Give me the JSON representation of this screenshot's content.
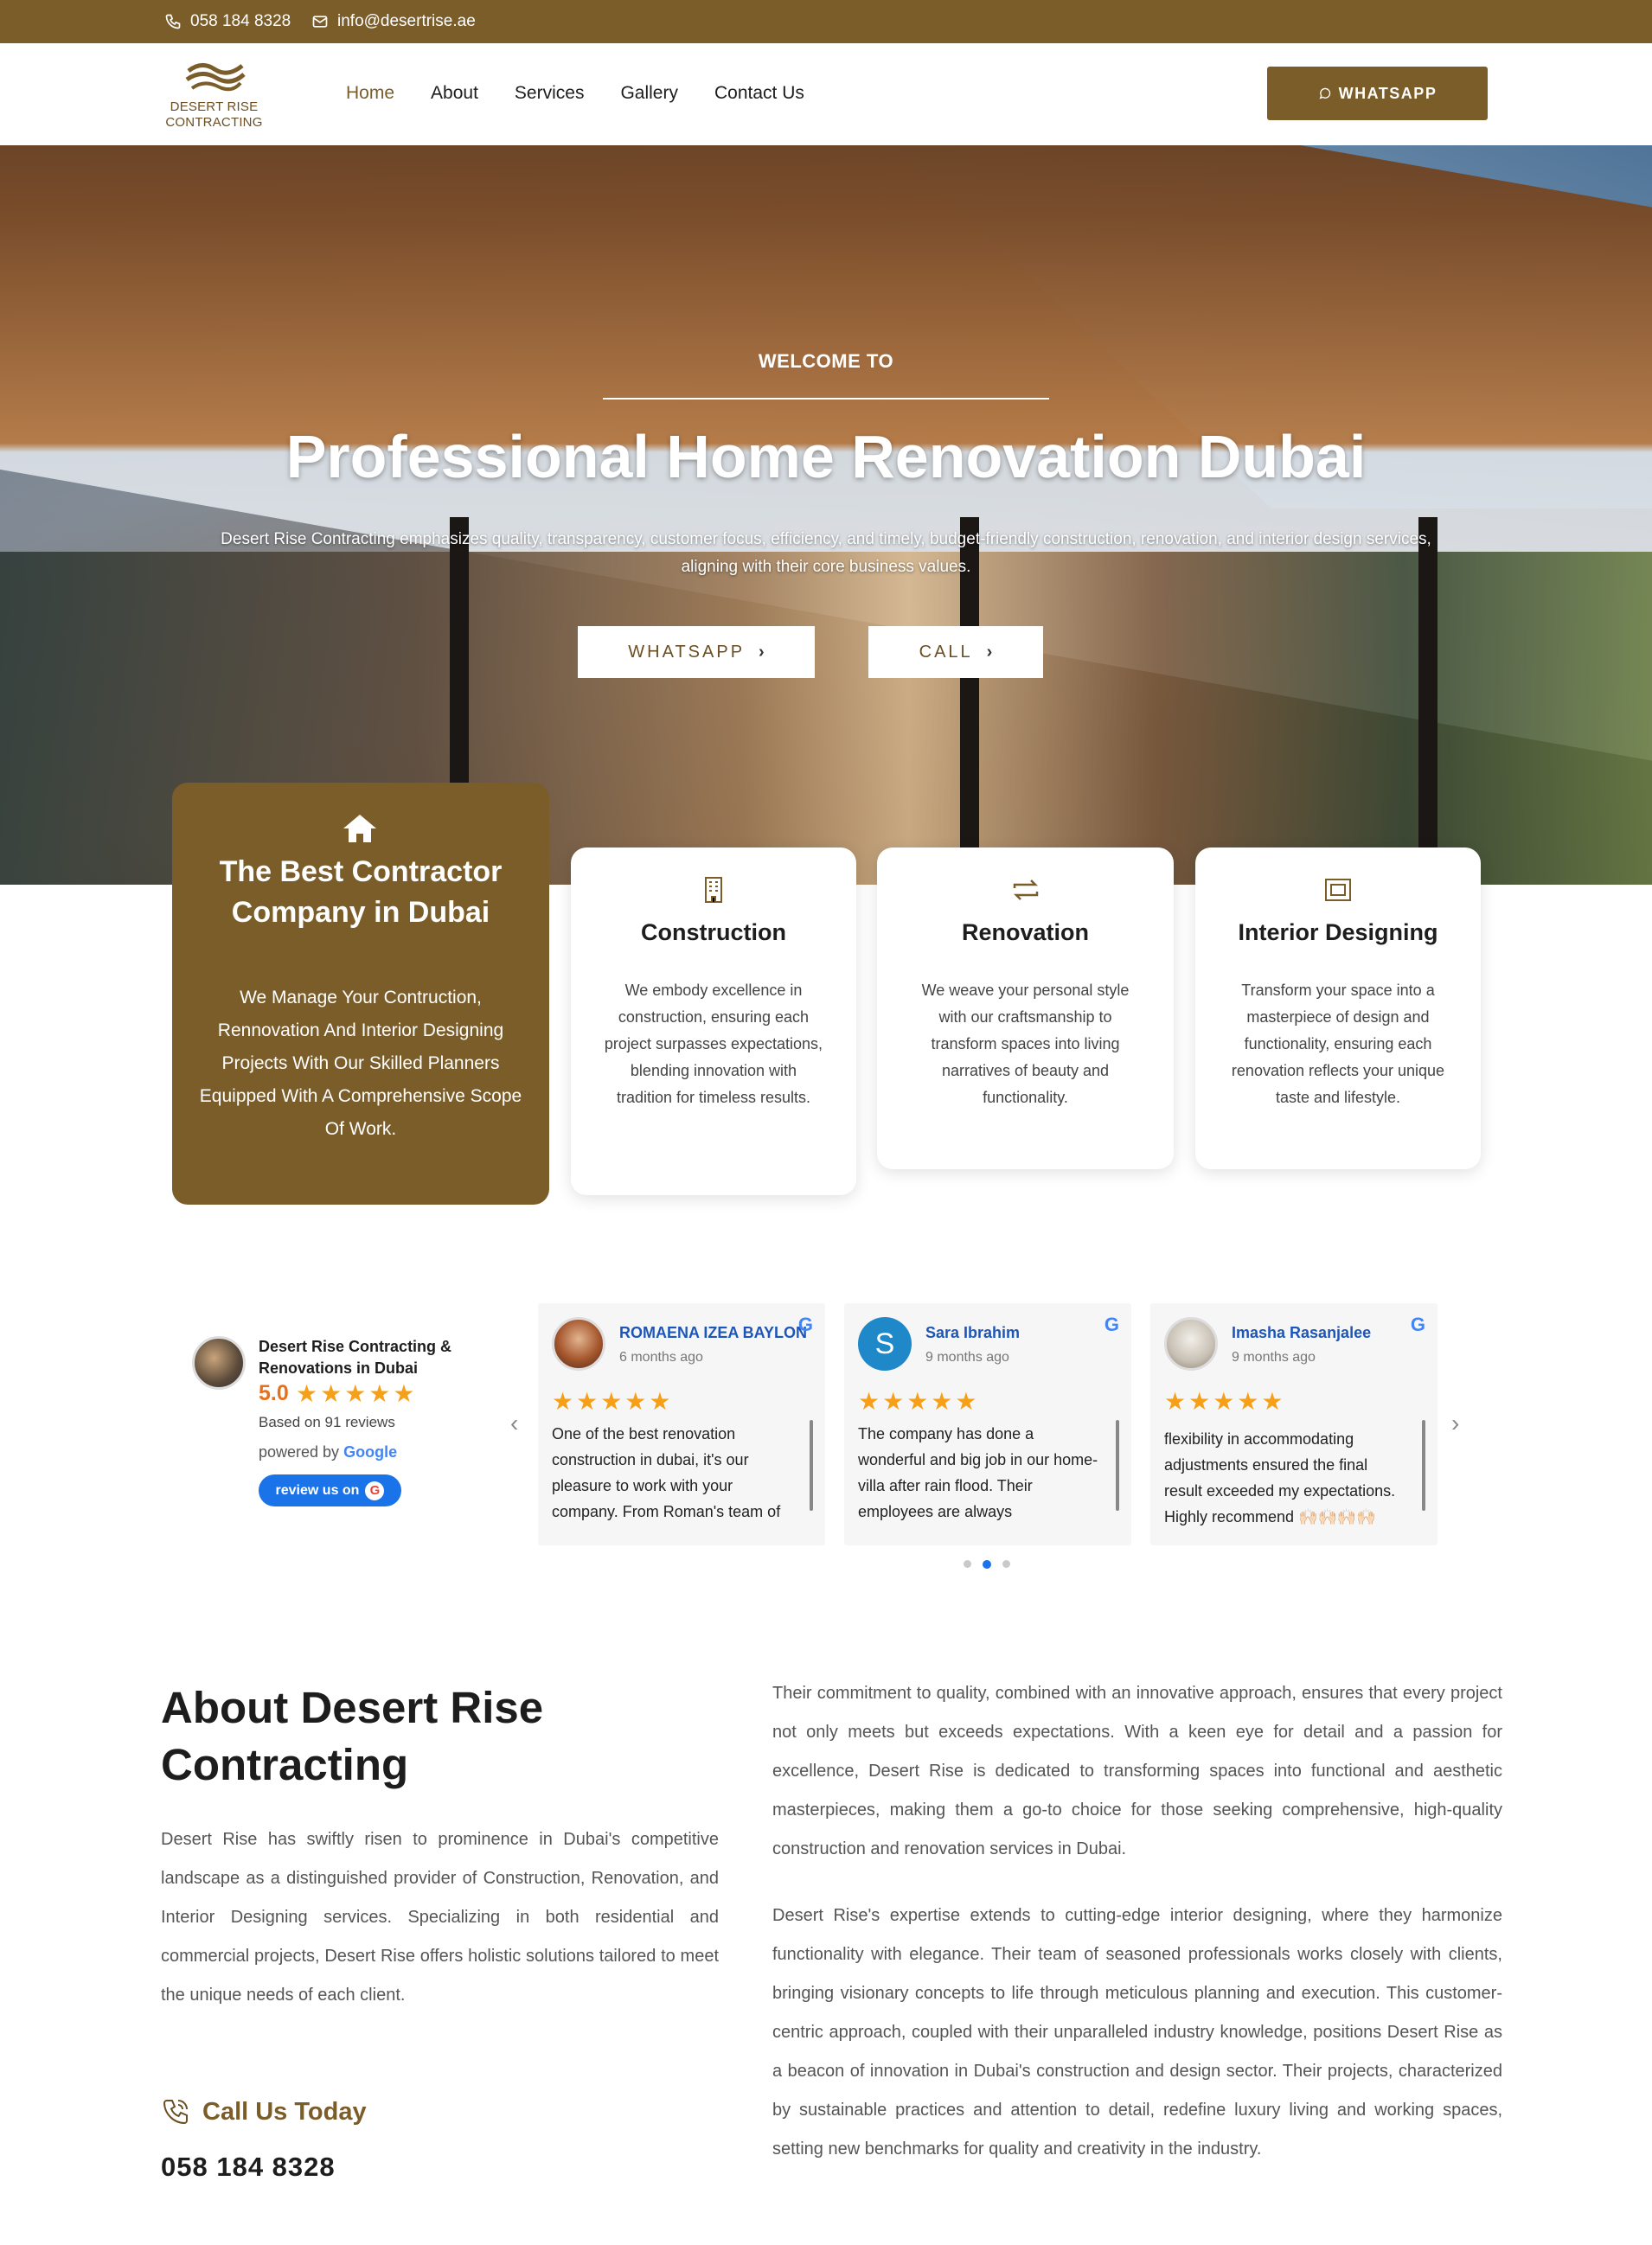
{
  "topbar": {
    "phone": "058 184 8328",
    "email": "info@desertrise.ae",
    "phone_icon": "phone-icon",
    "email_icon": "mail-icon"
  },
  "logo": {
    "line1": "DESERT RISE",
    "line2": "CONTRACTING"
  },
  "nav": {
    "items": [
      {
        "label": "Home",
        "active": true
      },
      {
        "label": "About",
        "active": false
      },
      {
        "label": "Services",
        "active": false
      },
      {
        "label": "Gallery",
        "active": false
      },
      {
        "label": "Contact Us",
        "active": false
      }
    ],
    "whatsapp_label": "WHATSAPP"
  },
  "hero": {
    "welcome": "WELCOME TO",
    "title": "Professional Home Renovation Dubai",
    "subtitle": "Desert Rise Contracting emphasizes quality, transparency, customer focus, efficiency, and timely, budget-friendly construction, renovation, and interior design services, aligning with their core business values.",
    "buttons": {
      "whatsapp": "WHATSAPP",
      "call": "CALL"
    }
  },
  "features": {
    "best": {
      "title": "The Best Contractor Company in Dubai",
      "description": "We Manage Your Contruction, Rennovation And Interior Designing Projects With Our Skilled Planners Equipped With A Comprehensive Scope Of Work."
    },
    "cards": [
      {
        "icon": "building-icon",
        "title": "Construction",
        "description": "We embody excellence in construction, ensuring each project surpasses expectations, blending innovation with tradition for timeless results."
      },
      {
        "icon": "repeat-icon",
        "title": "Renovation",
        "description": "We weave your personal style with our craftsmanship to transform spaces into living narratives of beauty and functionality."
      },
      {
        "icon": "frame-icon",
        "title": "Interior Designing",
        "description": "Transform your space into a masterpiece of design and functionality, ensuring each renovation reflects your unique taste and lifestyle."
      }
    ]
  },
  "reviews": {
    "business_name": "Desert Rise Contracting & Renovations in Dubai",
    "score": "5.0",
    "stars": "★★★★★",
    "based_on": "Based on 91 reviews",
    "powered_by": "powered by",
    "google": "Google",
    "review_button": "review us on",
    "items": [
      {
        "name": "ROMAENA IZEA BAYLON",
        "date": "6 months ago",
        "stars": "★★★★★",
        "text": "One of the best renovation construction in dubai, it's our pleasure to work with your company. From Roman's team of"
      },
      {
        "name": "Sara Ibrahim",
        "date": "9 months ago",
        "stars": "★★★★★",
        "initial": "S",
        "text": "The company has done a wonderful and big job in our home-villa after rain flood. Their employees are always"
      },
      {
        "name": "Imasha Rasanjalee",
        "date": "9 months ago",
        "stars": "★★★★★",
        "text": "flexibility in accommodating adjustments ensured the final result exceeded my expectations. Highly recommend 🙌🏻🙌🏻🙌🏻🙌🏻"
      }
    ],
    "active_dot": 1
  },
  "about": {
    "title": "About Desert Rise Contracting",
    "paragraph": "Desert Rise has swiftly risen to prominence in Dubai's competitive landscape as a distinguished provider of Construction, Renovation, and Interior Designing services. Specializing in both residential and commercial projects, Desert Rise offers holistic solutions tailored to meet the unique needs of each client.",
    "call_label": "Call Us Today",
    "call_number": "058 184 8328",
    "right_p1": "Their commitment to quality, combined with an innovative approach, ensures that every project not only meets but exceeds expectations. With a keen eye for detail and a passion for excellence, Desert Rise is dedicated to transforming spaces into functional and aesthetic masterpieces, making them a go-to choice for those seeking comprehensive, high-quality construction and renovation services in Dubai.",
    "right_p2": "Desert Rise's expertise extends to cutting-edge interior designing, where they harmonize functionality with elegance. Their team of seasoned professionals works closely with clients, bringing visionary concepts to life through meticulous planning and execution. This customer-centric approach, coupled with their unparalleled industry knowledge, positions Desert Rise as a beacon of innovation in Dubai's construction and design sector. Their projects, characterized by sustainable practices and attention to detail, redefine luxury living and working spaces, setting new benchmarks for quality and creativity in the industry."
  },
  "colors": {
    "brand": "#7b5d2a",
    "link": "#1e56b8",
    "star": "#f6a01a",
    "google_blue": "#1a73e8"
  }
}
